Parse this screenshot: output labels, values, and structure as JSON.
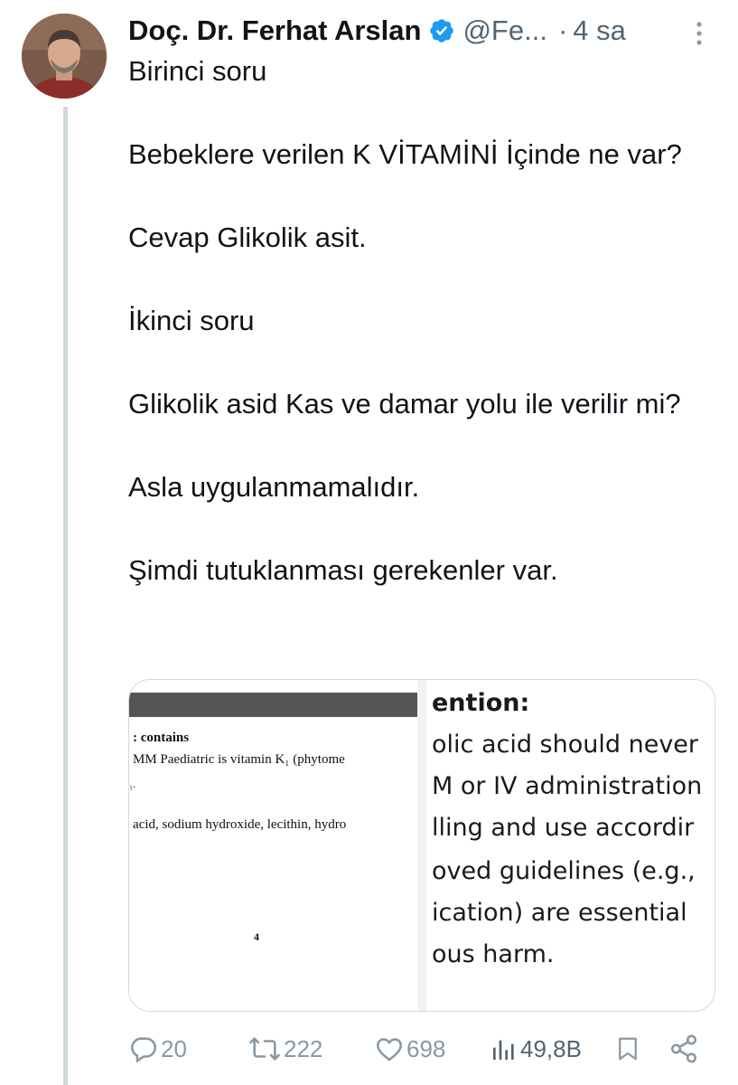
{
  "author": {
    "name": "Doç. Dr. Ferhat Arslan",
    "handle": "@Fe...",
    "separator": "·",
    "time": "4 sa"
  },
  "tweet": {
    "paragraphs": [
      "Birinci soru",
      "Bebeklere verilen K VİTAMİNİ İçinde ne var?",
      "Cevap Glikolik asit.",
      "İkinci soru",
      "Glikolik asid Kas ve damar yolu ile verilir mi?",
      "Asla uygulanmamalıdır.",
      "Şimdi tutuklanması gerekenler var."
    ]
  },
  "media": {
    "left": {
      "heading": ": contains",
      "line1": "MM Paediatric is vitamin K₁ (phytome",
      "line2": "₁.",
      "line3": "acid, sodium hydroxide, lecithin, hydro",
      "page_number": "4"
    },
    "right": {
      "lines": [
        "ention:",
        "olic acid should never",
        "M or IV administration",
        "lling and use accordir",
        "oved guidelines (e.g.,",
        "ication) are essential",
        "ous harm."
      ]
    }
  },
  "actions": {
    "replies": "20",
    "retweets": "222",
    "likes": "698",
    "views": "49,8B"
  },
  "colors": {
    "verified": "#1d9bf0",
    "muted": "#536471",
    "icon": "#8a98a5",
    "thread_line": "#cfd9de"
  },
  "icons": {
    "verified": "verified-badge-icon",
    "more": "more-vertical-icon",
    "reply": "reply-icon",
    "retweet": "retweet-icon",
    "like": "heart-icon",
    "views": "views-icon",
    "bookmark": "bookmark-icon",
    "share": "share-icon"
  }
}
